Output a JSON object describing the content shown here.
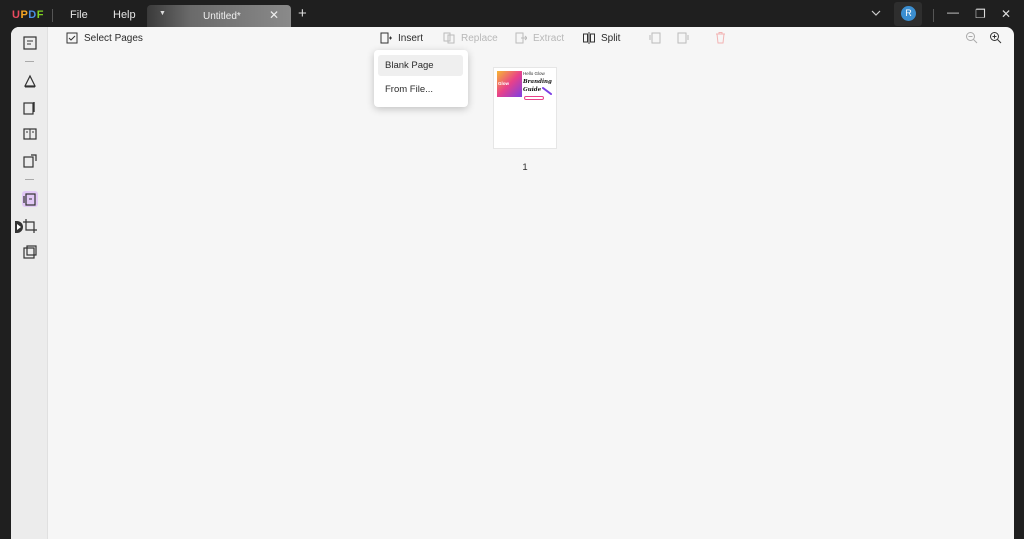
{
  "app": {
    "logo_letters": [
      "U",
      "P",
      "D",
      "F"
    ],
    "logo_colors": [
      "#e84a5f",
      "#f5a623",
      "#4a90e2",
      "#7ed321"
    ],
    "menu": {
      "file": "File",
      "help": "Help"
    }
  },
  "tab": {
    "title": "Untitled*",
    "close": "✕",
    "add": "+",
    "caret": "▼"
  },
  "user": {
    "avatar_initial": "R"
  },
  "window": {
    "minimize": "—",
    "restore": "❐",
    "close": "✕"
  },
  "toolbar": {
    "select_pages": "Select Pages",
    "insert": "Insert",
    "replace": "Replace",
    "extract": "Extract",
    "split": "Split"
  },
  "insert_menu": {
    "items": [
      "Blank Page",
      "From File..."
    ]
  },
  "thumbnail": {
    "page_number": "1",
    "badge_text": "Glow",
    "line1": "Hello Glow",
    "line2": "Branding",
    "line3": "Guide"
  },
  "colors": {
    "accent_purple": "#e2c9f6",
    "avatar": "#3b8ed0",
    "delete_disabled": "#f2b3b3"
  }
}
